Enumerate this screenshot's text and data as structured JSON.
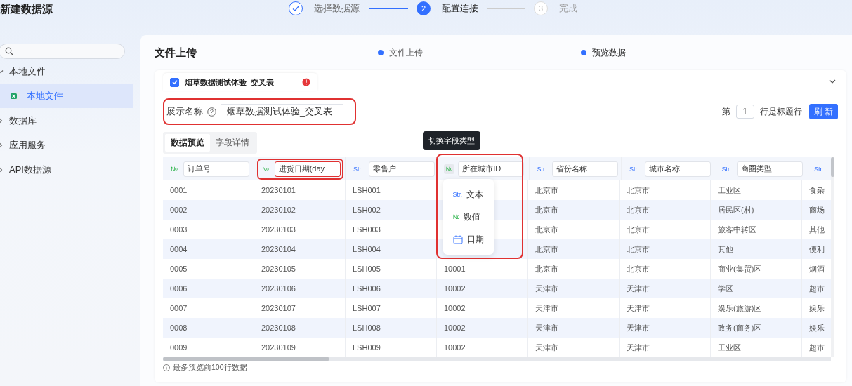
{
  "page_title": "新建数据源",
  "steps": [
    {
      "label": "选择数据源",
      "completed": true,
      "current": false
    },
    {
      "label": "配置连接",
      "number": "2",
      "completed": false,
      "current": true
    },
    {
      "label": "完成",
      "number": "3",
      "completed": false,
      "current": false
    }
  ],
  "sidebar": {
    "items": [
      {
        "label": "本地文件",
        "expanded": true,
        "selected": false,
        "children": [
          {
            "label": "本地文件",
            "selected": true
          }
        ]
      },
      {
        "label": "数据库",
        "expanded": false,
        "selected": false
      },
      {
        "label": "应用服务",
        "expanded": false,
        "selected": false
      },
      {
        "label": "API数据源",
        "expanded": false,
        "selected": false
      }
    ]
  },
  "section_title": "文件上传",
  "sub_steps": [
    "文件上传",
    "预览数据"
  ],
  "file_card": {
    "checked": true,
    "name": "烟草数据测试体验_交叉表",
    "error": true,
    "display_name": {
      "label": "展示名称",
      "value": "烟草数据测试体验_交叉表",
      "highlighted": true
    },
    "header_row": {
      "prefix": "第",
      "value": "1",
      "suffix": "行是标题行"
    },
    "refresh_button": "刷 新",
    "tabs": [
      {
        "label": "数据预览",
        "selected": true
      },
      {
        "label": "字段详情",
        "selected": false
      }
    ],
    "tooltip": "切换字段类型",
    "type_menu": [
      {
        "kind": "str",
        "mark": "Str.",
        "label": "文本"
      },
      {
        "kind": "num",
        "mark": "№",
        "label": "数值"
      },
      {
        "kind": "date",
        "label": "日期"
      }
    ],
    "columns": [
      {
        "kind": "num",
        "mark": "№",
        "name": "订单号",
        "highlighted": false,
        "menu_open": false
      },
      {
        "kind": "num",
        "mark": "№",
        "name": "进货日期(day",
        "highlighted": true,
        "menu_open": false
      },
      {
        "kind": "str",
        "mark": "Str.",
        "name": "零售户",
        "highlighted": false,
        "menu_open": false
      },
      {
        "kind": "num",
        "mark": "№",
        "name": "所在城市ID",
        "highlighted": true,
        "menu_open": true
      },
      {
        "kind": "str",
        "mark": "Str.",
        "name": "省份名称",
        "highlighted": false,
        "menu_open": false
      },
      {
        "kind": "str",
        "mark": "Str.",
        "name": "城市名称",
        "highlighted": false,
        "menu_open": false
      },
      {
        "kind": "str",
        "mark": "Str.",
        "name": "商圈类型",
        "highlighted": false,
        "menu_open": false
      },
      {
        "kind": "str",
        "mark": "Str.",
        "highlighted": false,
        "menu_open": false
      }
    ],
    "rows": [
      [
        "0001",
        "20230101",
        "LSH001",
        null,
        "北京市",
        "北京市",
        "工业区",
        "食杂"
      ],
      [
        "0002",
        "20230102",
        "LSH002",
        null,
        "北京市",
        "北京市",
        "居民区(村)",
        "商场"
      ],
      [
        "0003",
        "20230103",
        "LSH003",
        null,
        "北京市",
        "北京市",
        "旅客中转区",
        "其他"
      ],
      [
        "0004",
        "20230104",
        "LSH004",
        null,
        "北京市",
        "北京市",
        "其他",
        "便利"
      ],
      [
        "0005",
        "20230105",
        "LSH005",
        "10001",
        "北京市",
        "北京市",
        "商业(集贸)区",
        "烟酒"
      ],
      [
        "0006",
        "20230106",
        "LSH006",
        "10002",
        "天津市",
        "天津市",
        "学区",
        "超市"
      ],
      [
        "0007",
        "20230107",
        "LSH007",
        "10002",
        "天津市",
        "天津市",
        "娱乐(旅游)区",
        "娱乐"
      ],
      [
        "0008",
        "20230108",
        "LSH008",
        "10002",
        "天津市",
        "天津市",
        "政务(商务)区",
        "娱乐"
      ],
      [
        "0009",
        "20230109",
        "LSH009",
        "10002",
        "天津市",
        "天津市",
        "工业区",
        "超市"
      ]
    ],
    "footnote": "最多预览前100行数据"
  }
}
